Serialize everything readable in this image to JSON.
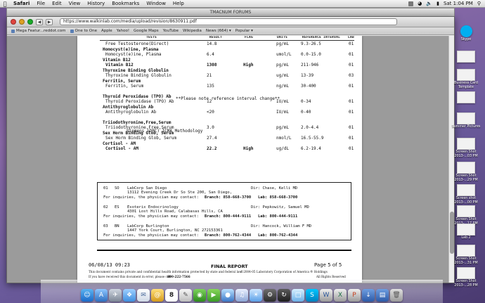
{
  "menubar": {
    "app": "Safari",
    "items": [
      "File",
      "Edit",
      "View",
      "History",
      "Bookmarks",
      "Window",
      "Help"
    ],
    "clock": "Sat 1:04 PM"
  },
  "back_window": {
    "title": "TMACNUM FORUMS"
  },
  "front_window": {
    "address": "https://www.walkinlab.com/media/upload/revision/8630911.pdf",
    "bookmarks": [
      "Mega Featur...reddot.com",
      "One to One",
      "Apple",
      "Yahoo!",
      "Google Maps",
      "YouTube",
      "Wikipedia",
      "News (664) ▾",
      "Popular ▾"
    ]
  },
  "report": {
    "headers": [
      "TESTS",
      "RESULT",
      "FLAG",
      "UNITS",
      "REFERENCE INTERVAL",
      "LAB"
    ],
    "rows": [
      {
        "test": "Free Testosterone(Direct)",
        "result": "14.8",
        "flag": "",
        "units": "pg/mL",
        "ref": "9.3-26.5",
        "lab": "01",
        "bold": false,
        "indent": true
      },
      {
        "test": "Homocyst(e)ine, Plasma",
        "bold": true,
        "header": true
      },
      {
        "test": "Homocyst(e)ine, Plasma",
        "result": "6.4",
        "flag": "",
        "units": "umol/L",
        "ref": "0.0-15.0",
        "lab": "01",
        "bold": false,
        "indent": true
      },
      {
        "test": "Vitamin B12",
        "bold": true,
        "header": true
      },
      {
        "test": "Vitamin B12",
        "result": "1308",
        "flag": "High",
        "units": "pg/mL",
        "ref": "211-946",
        "lab": "01",
        "bold": true,
        "indent": true
      },
      {
        "test": "Thyroxine Binding Globulin",
        "bold": true,
        "header": true
      },
      {
        "test": "Thyroxine Binding Globulin",
        "result": "21",
        "flag": "",
        "units": "ug/mL",
        "ref": "13-39",
        "lab": "03",
        "bold": false,
        "indent": true
      },
      {
        "test": "Ferritin, Serum",
        "bold": true,
        "header": true
      },
      {
        "test": "Ferritin, Serum",
        "result": "135",
        "flag": "",
        "units": "ng/mL",
        "ref": "30-400",
        "lab": "01",
        "bold": false,
        "indent": true
      },
      {
        "test": "Thyroid Peroxidase (TPO) Ab",
        "bold": true,
        "header": true
      },
      {
        "test": "Thyroid Peroxidase (TPO) Ab",
        "result": "12",
        "flag": "",
        "units": "IU/mL",
        "ref": "0-34",
        "lab": "01",
        "bold": false,
        "indent": true
      },
      {
        "test": "Antithyroglobulin Ab",
        "bold": true,
        "header": true
      },
      {
        "test": "Antithyroglobulin Ab",
        "result": "<20",
        "flag": "",
        "units": "IU/mL",
        "ref": "0-40",
        "lab": "01",
        "bold": false,
        "indent": true
      },
      {
        "test": "Triiodothyronine,Free,Serum",
        "bold": true,
        "header": true
      },
      {
        "test": "Triiodothyronine,Free,Serum",
        "result": "3.0",
        "flag": "",
        "units": "pg/mL",
        "ref": "2.0-4.4",
        "lab": "01",
        "bold": false,
        "indent": true
      },
      {
        "test": "Sex Horm Binding Glob, Serum",
        "bold": true,
        "header": true
      },
      {
        "test": "Sex Horm Binding Glob, Serum",
        "result": "27.4",
        "flag": "",
        "units": "nmol/L",
        "ref": "16.5-55.9",
        "lab": "01",
        "bold": false,
        "indent": true
      },
      {
        "test": "Cortisol - AM",
        "bold": true,
        "header": true
      },
      {
        "test": "Cortisol - AM",
        "result": "22.2",
        "flag": "High",
        "units": "ug/dL",
        "ref": "6.2-19.4",
        "lab": "01",
        "bold": true,
        "indent": true
      }
    ],
    "notes": {
      "ferritin": "**Please note reference interval change**",
      "antithyro": "Siemens (DPC) ICMA Methodology"
    }
  },
  "labs": [
    {
      "num": "01",
      "code": "SO",
      "name": "LabCorp San Diego",
      "address": "13112 Evening Creek Dr So  Ste 200, San Diego,",
      "dir": "Dir: Chase, Kelli MD",
      "inquiry": "For inquiries, the physician may contact:",
      "branch": "Branch: 858-668-3700",
      "lab": "Lab: 858-668-3700"
    },
    {
      "num": "02",
      "code": "ES",
      "name": "Esoterix Endocrinology",
      "address": "4301 Lost Hills Road, Calabasas Hills, CA",
      "dir": "Dir: Pepkowitz, Samuel MD",
      "inquiry": "For inquiries, the physician may contact:",
      "branch": "Branch: 800-444-9111",
      "lab": "Lab: 800-444-9111"
    },
    {
      "num": "03",
      "code": "BN",
      "name": "LabCorp Burlington",
      "address": "1447 York Court, Burlington, NC 272153361",
      "dir": "Dir: Hancock, William F MD",
      "inquiry": "For inquiries, the physician may contact:",
      "branch": "Branch: 800-762-4344",
      "lab": "Lab: 800-762-4344"
    }
  ],
  "footer": {
    "date": "06/08/13 09:23",
    "title": "FINAL REPORT",
    "page": "Page 5 of 5",
    "confidential": "This document contains private and confidential health information protected by state and federal law.",
    "copyright": "©2004-05 Laboratory Corporation of America ® Holdings",
    "error": "If you have received this document in error, please call",
    "phone": "800-222-7566",
    "rights": "All Rights Reserved"
  },
  "desktop_icons": [
    {
      "label": "Skype"
    },
    {
      "label": ""
    },
    {
      "label": "Business Card Template"
    },
    {
      "label": ""
    },
    {
      "label": "Summer Pictures"
    },
    {
      "label": "Screen Shot 2013-...03 PM"
    },
    {
      "label": "Screen Shot 2013-...29 PM"
    },
    {
      "label": "Screen shot 2013-...00 PM"
    },
    {
      "label": "Screen Shot 2013-...17 PM"
    },
    {
      "label": "Lab 2"
    },
    {
      "label": "Screen Shot 2013-...31 PM"
    },
    {
      "label": "Screen Shot 2013-...28 PM"
    }
  ],
  "dock": {
    "calendar_day": "8"
  },
  "colors": {
    "desktop": "#6a4f8e",
    "skype": "#00aff0",
    "red_light": "#e0443e",
    "yellow_light": "#dea123",
    "green_light": "#1aab29"
  }
}
